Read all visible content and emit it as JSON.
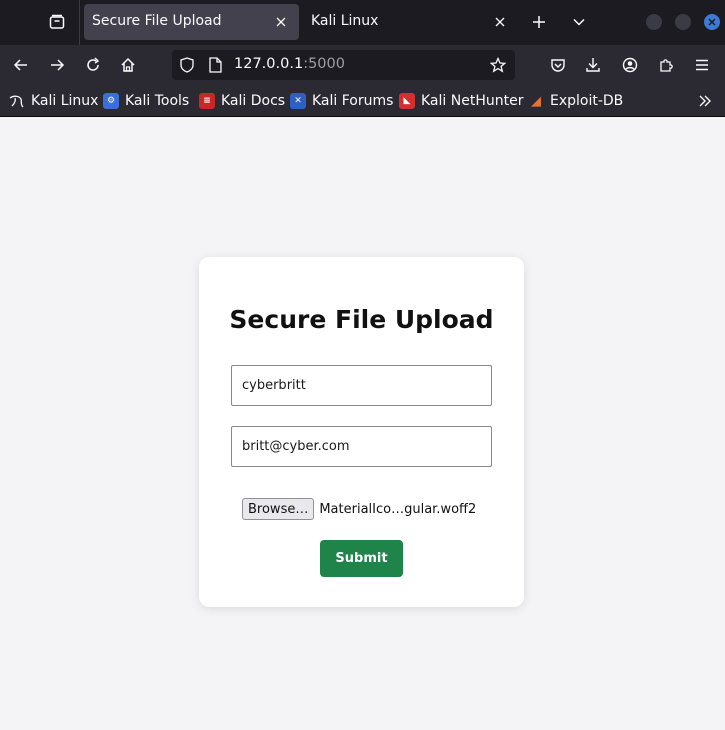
{
  "browser": {
    "tabs": [
      {
        "title": "Secure File Upload",
        "active": true
      },
      {
        "title": "Kali Linux",
        "active": false
      }
    ],
    "url": {
      "host": "127.0.0.1",
      "port": ":5000"
    },
    "bookmarks": [
      {
        "label": "Kali Linux",
        "icon": "kali-dragon-icon",
        "color": "#2b2a33"
      },
      {
        "label": "Kali Tools",
        "icon": "kali-tools-icon",
        "color": "#3a6fd8"
      },
      {
        "label": "Kali Docs",
        "icon": "kali-docs-icon",
        "color": "#c62828"
      },
      {
        "label": "Kali Forums",
        "icon": "kali-forums-icon",
        "color": "#2f5fc4"
      },
      {
        "label": "Kali NetHunter",
        "icon": "kali-nethunter-icon",
        "color": "#d32f2f"
      },
      {
        "label": "Exploit-DB",
        "icon": "exploit-db-icon",
        "color": "#e8732c"
      }
    ],
    "accent": "#3d7bd6"
  },
  "page": {
    "title": "Secure File Upload",
    "username_value": "cyberbritt",
    "email_value": "britt@cyber.com",
    "browse_label": "Browse…",
    "file_name": "MaterialIco…gular.woff2",
    "submit_label": "Submit",
    "submit_color": "#1e8449"
  }
}
